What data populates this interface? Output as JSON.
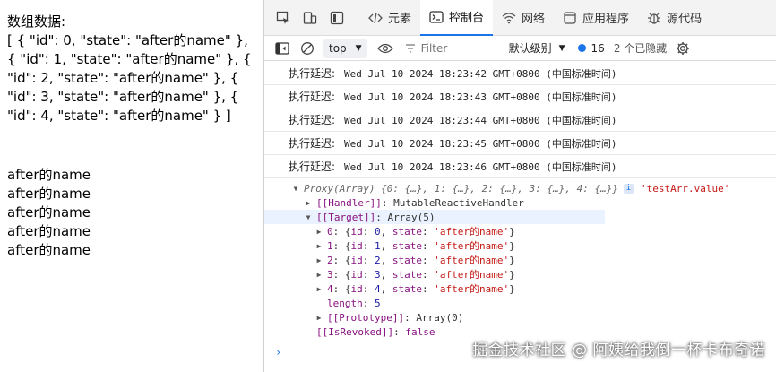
{
  "page": {
    "label": "数组数据:",
    "json_text": "[ { \"id\": 0, \"state\": \"after的name\" }, { \"id\": 1, \"state\": \"after的name\" }, { \"id\": 2, \"state\": \"after的name\" }, { \"id\": 3, \"state\": \"after的name\" }, { \"id\": 4, \"state\": \"after的name\" } ]",
    "items": [
      "after的name",
      "after的name",
      "after的name",
      "after的name",
      "after的name"
    ]
  },
  "devtools": {
    "tabs": [
      {
        "label": "元素",
        "icon": "code-icon"
      },
      {
        "label": "控制台",
        "icon": "console-icon",
        "active": true
      },
      {
        "label": "网络",
        "icon": "wifi-icon"
      },
      {
        "label": "应用程序",
        "icon": "app-icon"
      },
      {
        "label": "源代码",
        "icon": "bug-icon"
      }
    ],
    "toolbar": {
      "context": "top",
      "filter_placeholder": "Filter",
      "levels": "默认级别",
      "issues_count": "16",
      "hidden": "2 个已隐藏"
    },
    "console": {
      "log_label": "执行延迟:",
      "logs": [
        "Wed Jul 10 2024 18:23:42 GMT+0800 (中国标准时间)",
        "Wed Jul 10 2024 18:23:43 GMT+0800 (中国标准时间)",
        "Wed Jul 10 2024 18:23:44 GMT+0800 (中国标准时间)",
        "Wed Jul 10 2024 18:23:45 GMT+0800 (中国标准时间)",
        "Wed Jul 10 2024 18:23:46 GMT+0800 (中国标准时间)"
      ],
      "proxy_summary": "Proxy(Array) {0: {…}, 1: {…}, 2: {…}, 3: {…}, 4: {…}}",
      "proxy_label": "'testArr.value'",
      "handler_key": "[[Handler]]",
      "handler_value": "MutableReactiveHandler",
      "target_key": "[[Target]]",
      "target_value": "Array(5)",
      "entries": [
        {
          "key": "0",
          "id": "0",
          "state": "'after的name'"
        },
        {
          "key": "1",
          "id": "1",
          "state": "'after的name'"
        },
        {
          "key": "2",
          "id": "2",
          "state": "'after的name'"
        },
        {
          "key": "3",
          "id": "3",
          "state": "'after的name'"
        },
        {
          "key": "4",
          "id": "4",
          "state": "'after的name'"
        }
      ],
      "length_key": "length",
      "length_value": "5",
      "prototype_key": "[[Prototype]]",
      "prototype_value": "Array(0)",
      "revoked_key": "[[IsRevoked]]",
      "revoked_value": "false",
      "prompt": "›"
    }
  },
  "watermark": "掘金技术社区 @ 阿姨给我倒一杯卡布奇诺"
}
